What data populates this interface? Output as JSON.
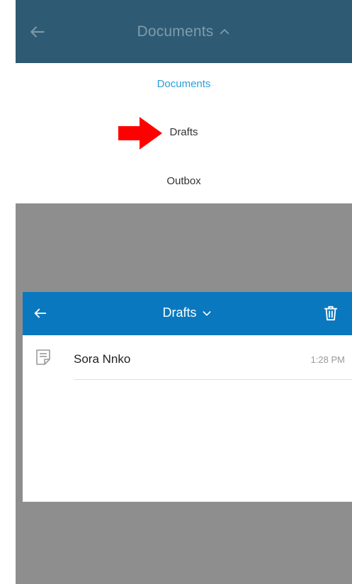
{
  "header": {
    "title": "Documents",
    "back_icon": "arrow-left-icon",
    "title_chevron_icon": "chevron-up-icon",
    "color": "#2e5b73"
  },
  "dropdown": {
    "items": [
      {
        "label": "Documents",
        "selected": true
      },
      {
        "label": "Drafts",
        "selected": false
      },
      {
        "label": "Outbox",
        "selected": false
      }
    ],
    "selected_color": "#2a9fd6"
  },
  "annotation": {
    "arrow_icon": "red-arrow-pointer-icon",
    "arrow_color": "#ff0000"
  },
  "drafts_screen": {
    "title": "Drafts",
    "back_icon": "arrow-left-icon",
    "title_chevron_icon": "chevron-down-icon",
    "trash_icon": "trash-icon",
    "bar_color": "#0a78be",
    "items": [
      {
        "name": "Sora Nnko",
        "time": "1:28 PM",
        "icon": "document-icon"
      }
    ]
  }
}
